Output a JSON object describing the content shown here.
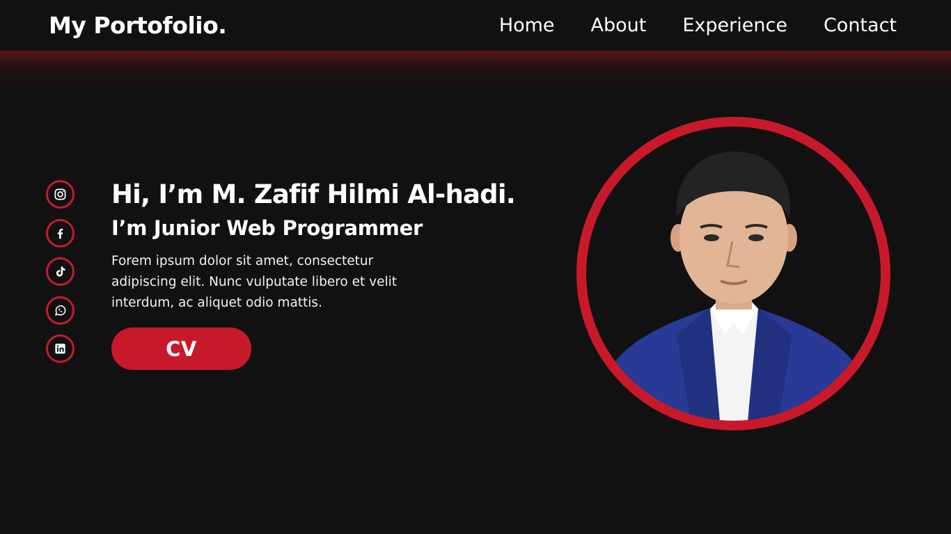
{
  "header": {
    "brand": "My Portofolio.",
    "nav": [
      {
        "label": "Home"
      },
      {
        "label": "About"
      },
      {
        "label": "Experience"
      },
      {
        "label": "Contact"
      }
    ]
  },
  "hero": {
    "headline": "Hi, I’m M. Zafif Hilmi Al-hadi.",
    "subheadline": "I’m Junior Web Programmer",
    "description": "Forem ipsum dolor sit amet, consectetur adipiscing elit. Nunc vulputate libero et velit interdum, ac aliquet odio mattis.",
    "cv_label": "CV"
  },
  "socials": [
    {
      "icon": "instagram-icon"
    },
    {
      "icon": "facebook-icon"
    },
    {
      "icon": "tiktok-icon"
    },
    {
      "icon": "whatsapp-icon"
    },
    {
      "icon": "linkedin-icon"
    }
  ],
  "theme": {
    "background": "#111111",
    "accent": "#c8192b",
    "text": "#ffffff"
  }
}
